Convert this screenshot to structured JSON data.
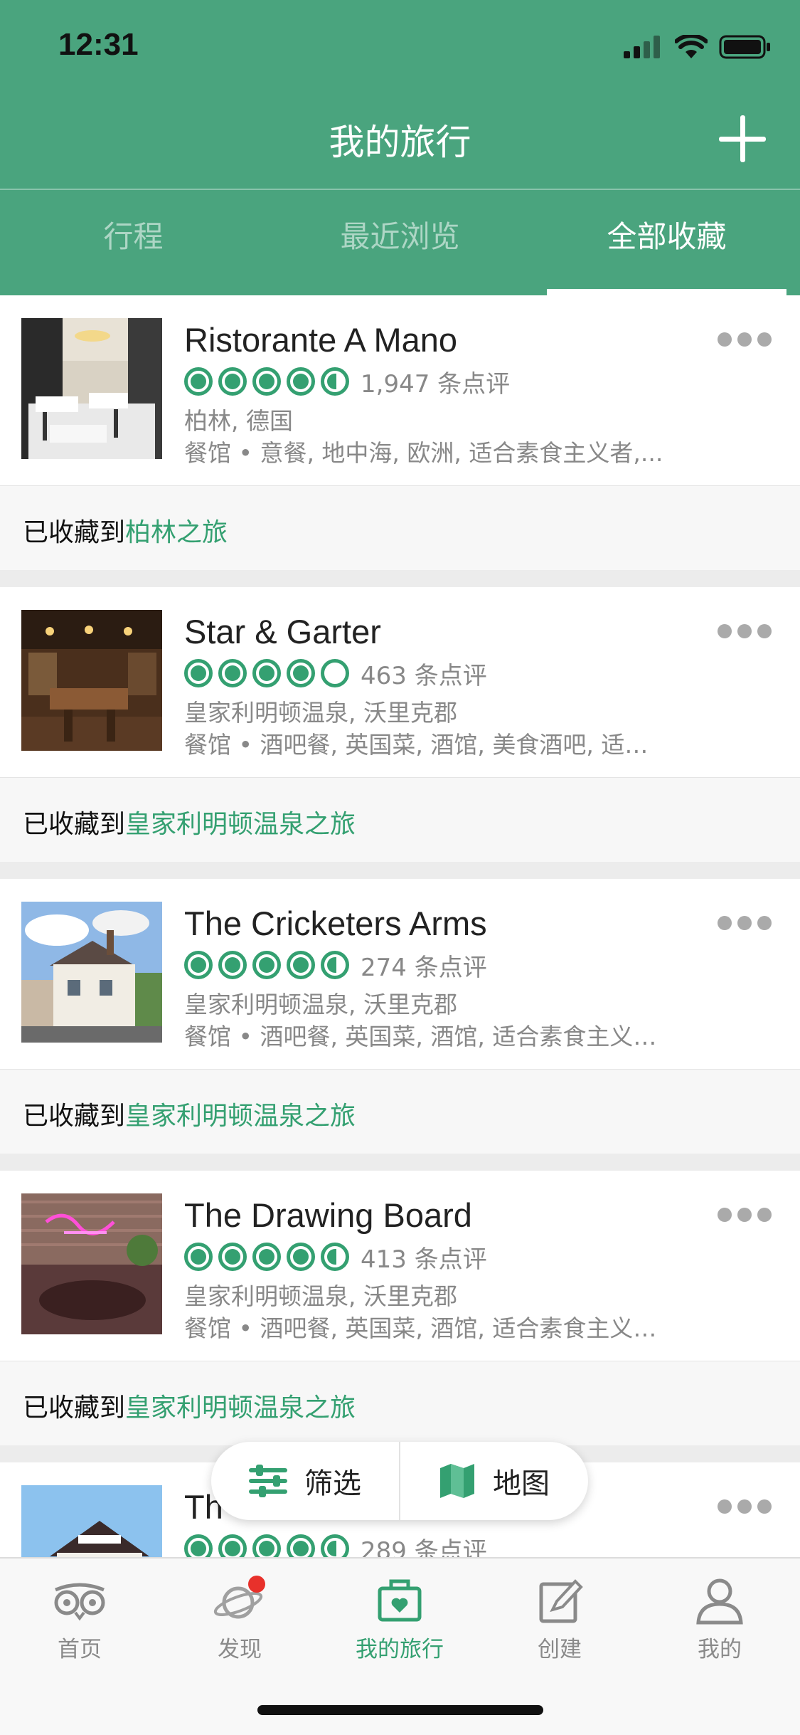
{
  "status_bar": {
    "time": "12:31"
  },
  "header": {
    "title": "我的旅行"
  },
  "tabs": [
    {
      "label": "行程"
    },
    {
      "label": "最近浏览"
    },
    {
      "label": "全部收藏"
    }
  ],
  "items": [
    {
      "name": "Ristorante A Mano",
      "rating": 4.5,
      "reviews": "1,947 条点评",
      "location": "柏林, 德国",
      "categories": "餐馆 • 意餐, 地中海, 欧洲, 适合素食主义者,...",
      "saved_prefix": "已收藏到",
      "saved_trip": "柏林之旅"
    },
    {
      "name": "Star & Garter",
      "rating": 4,
      "reviews": "463 条点评",
      "location": "皇家利明顿温泉, 沃里克郡",
      "categories": "餐馆 • 酒吧餐, 英国菜, 酒馆, 美食酒吧, 适合…",
      "saved_prefix": "已收藏到",
      "saved_trip": "皇家利明顿温泉之旅"
    },
    {
      "name": "The Cricketers Arms",
      "rating": 4.5,
      "reviews": "274 条点评",
      "location": "皇家利明顿温泉, 沃里克郡",
      "categories": "餐馆 • 酒吧餐, 英国菜, 酒馆, 适合素食主义…",
      "saved_prefix": "已收藏到",
      "saved_trip": "皇家利明顿温泉之旅"
    },
    {
      "name": "The Drawing Board",
      "rating": 4.5,
      "reviews": "413 条点评",
      "location": "皇家利明顿温泉, 沃里克郡",
      "categories": "餐馆 • 酒吧餐, 英国菜, 酒馆, 适合素食主义…",
      "saved_prefix": "已收藏到",
      "saved_trip": "皇家利明顿温泉之旅"
    },
    {
      "name": "Th",
      "rating": 4.5,
      "reviews": "289 条点评"
    }
  ],
  "float_bar": {
    "filter_label": "筛选",
    "map_label": "地图"
  },
  "tab_bar": [
    {
      "label": "首页"
    },
    {
      "label": "发现"
    },
    {
      "label": "我的旅行"
    },
    {
      "label": "创建"
    },
    {
      "label": "我的"
    }
  ],
  "colors": {
    "brand_green": "#4aa47e",
    "bubble_green": "#34a071",
    "badge_red": "#e8312b"
  }
}
